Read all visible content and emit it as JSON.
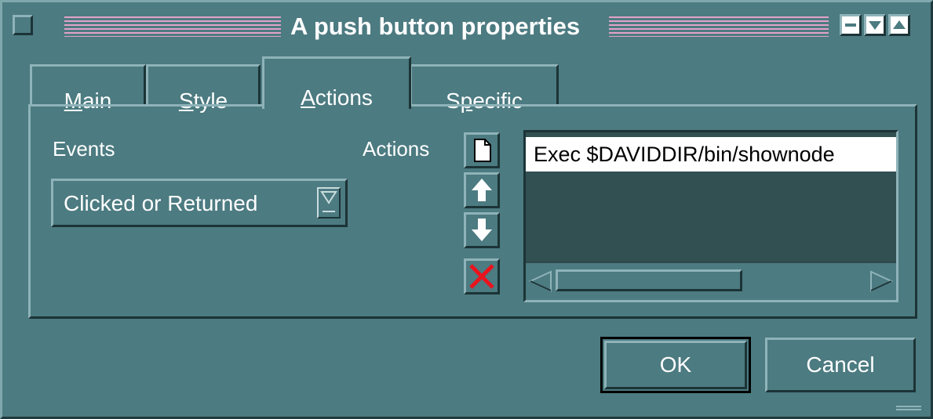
{
  "window": {
    "title": "A push button properties",
    "title_color": "#ffffff",
    "stripe_color": "#e3a2c8",
    "background": "#4c7b81"
  },
  "titlebar_controls": [
    {
      "name": "minimize",
      "icon": "minimize-icon"
    },
    {
      "name": "lower",
      "icon": "arrow-down-icon"
    },
    {
      "name": "raise",
      "icon": "arrow-up-icon"
    }
  ],
  "tabs": [
    {
      "label_mnemonic": "M",
      "label_rest": "ain",
      "active": false
    },
    {
      "label_mnemonic": "S",
      "label_rest": "tyle",
      "active": false
    },
    {
      "label_mnemonic": "A",
      "label_rest": "ctions",
      "active": true
    },
    {
      "label_pre": "S",
      "label_mnemonic": "p",
      "label_rest": "ecific",
      "active": false
    }
  ],
  "events": {
    "label": "Events",
    "selected": "Clicked or Returned"
  },
  "actions": {
    "label": "Actions",
    "buttons": [
      {
        "name": "new-action",
        "icon": "new-document-icon"
      },
      {
        "name": "move-up",
        "icon": "arrow-up-icon"
      },
      {
        "name": "move-down",
        "icon": "arrow-down-icon"
      },
      {
        "name": "delete-action",
        "icon": "delete-x-icon",
        "color": "#e8141e"
      }
    ],
    "items": [
      "Exec $DAVIDDIR/bin/shownode"
    ]
  },
  "buttons": {
    "ok": "OK",
    "cancel": "Cancel"
  }
}
